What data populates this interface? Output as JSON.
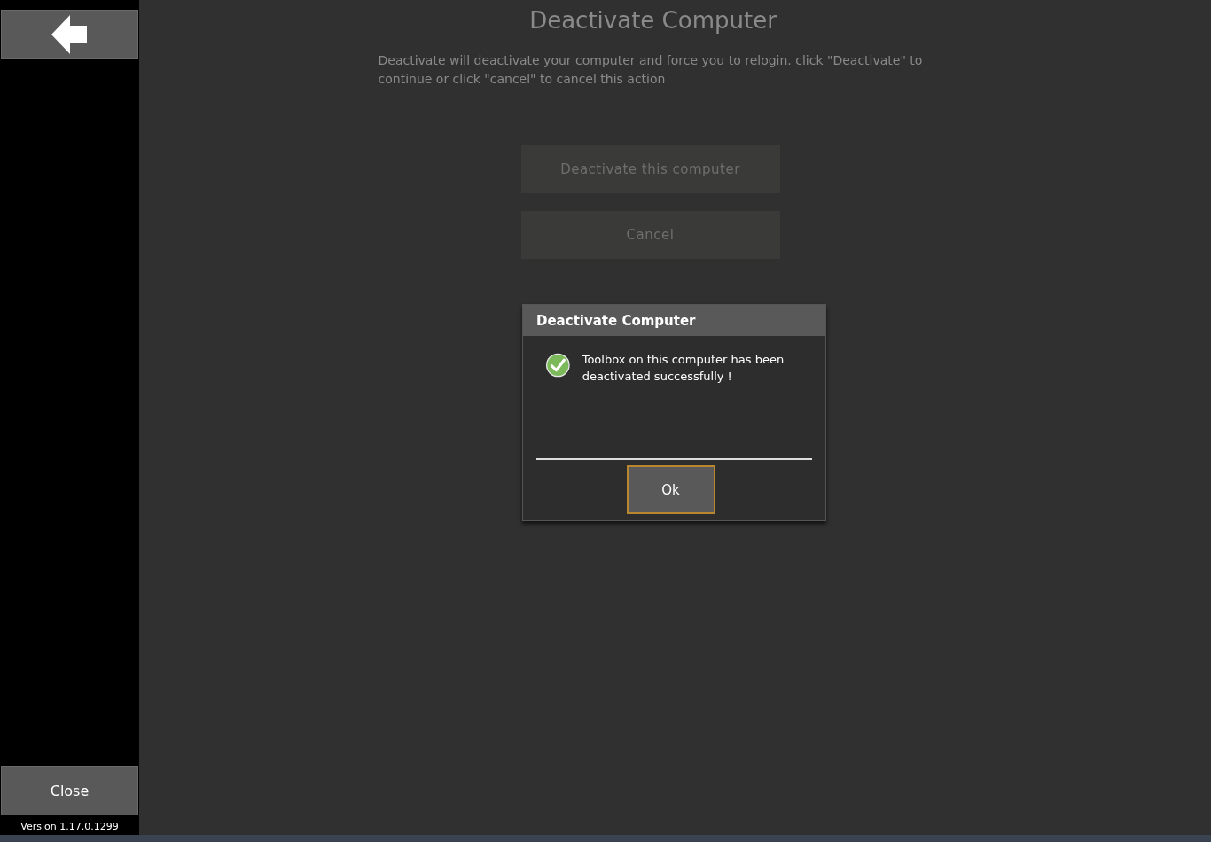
{
  "sidebar": {
    "close_button": {
      "label": "Close"
    },
    "version": "Version 1.17.0.1299"
  },
  "main": {
    "title": "Deactivate Computer",
    "description": "Deactivate will deactivate your computer and force you to relogin. click \"Deactivate\" to continue or click \"cancel\" to cancel this action",
    "buttons": [
      {
        "label": "Deactivate this computer",
        "disabled": true
      },
      {
        "label": "Cancel",
        "disabled": true
      }
    ]
  },
  "dialog": {
    "title": "Deactivate Computer",
    "message": "Toolbox on this computer has been deactivated successfully !",
    "buttons": [
      {
        "label": "Ok",
        "focused": true
      }
    ]
  }
}
